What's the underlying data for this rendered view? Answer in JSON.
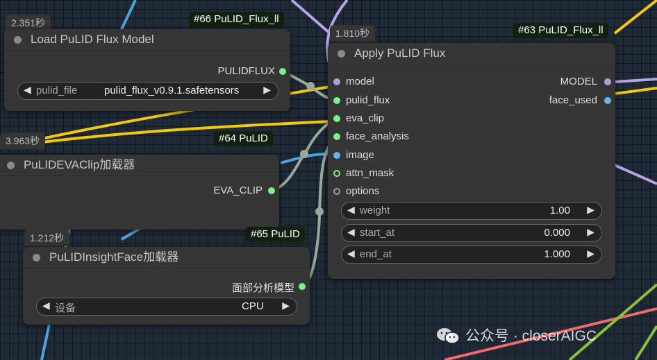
{
  "nodes": {
    "load_model": {
      "badge": "#66 PuLID_Flux_ll",
      "time": "2.351秒",
      "title": "Load PuLID Flux Model",
      "output": "PULIDFLUX",
      "widget": {
        "label": "pulid_file",
        "value": "pulid_flux_v0.9.1.safetensors"
      }
    },
    "eva_clip": {
      "badge": "#64 PuLID",
      "time": "3.963秒",
      "title": "PuLIDEVAClip加载器",
      "output": "EVA_CLIP"
    },
    "insightface": {
      "badge": "#65 PuLID",
      "time": "1.212秒",
      "title": "PuLIDInsightFace加载器",
      "output": "面部分析模型",
      "widget": {
        "label": "设备",
        "value": "CPU"
      }
    },
    "apply": {
      "badge": "#63 PuLID_Flux_ll",
      "time": "1.810秒",
      "title": "Apply PuLID Flux",
      "inputs": [
        "model",
        "pulid_flux",
        "eva_clip",
        "face_analysis",
        "image",
        "attn_mask",
        "options"
      ],
      "outputs": [
        "MODEL",
        "face_used"
      ],
      "widgets": [
        {
          "label": "weight",
          "value": "1.00"
        },
        {
          "label": "start_at",
          "value": "0.000"
        },
        {
          "label": "end_at",
          "value": "1.000"
        }
      ]
    }
  },
  "watermark": "公众号 · closerAIGC",
  "colors": {
    "model": "#b39ddb",
    "green": "#7cf08a",
    "image": "#64b5f6",
    "wire_gray": "#9aa89a",
    "wire_yellow": "#f2c90f",
    "wire_blue": "#4aa3df",
    "wire_purple": "#b7a3e6"
  }
}
